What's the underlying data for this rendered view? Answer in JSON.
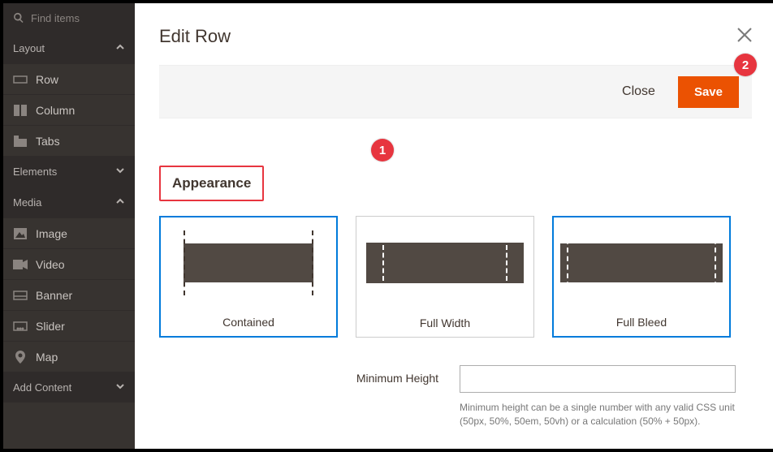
{
  "search": {
    "placeholder": "Find items"
  },
  "sidebar": {
    "groups": {
      "layout": {
        "label": "Layout",
        "expanded": true,
        "items": [
          "Row",
          "Column",
          "Tabs"
        ]
      },
      "elements": {
        "label": "Elements",
        "expanded": false,
        "items": []
      },
      "media": {
        "label": "Media",
        "expanded": true,
        "items": [
          "Image",
          "Video",
          "Banner",
          "Slider",
          "Map"
        ]
      },
      "addcontent": {
        "label": "Add Content",
        "expanded": false,
        "items": []
      }
    }
  },
  "modal": {
    "title": "Edit Row",
    "buttons": {
      "close": "Close",
      "save": "Save"
    },
    "appearance": {
      "section_label": "Appearance",
      "options": [
        {
          "key": "contained",
          "label": "Contained"
        },
        {
          "key": "fullwidth",
          "label": "Full Width"
        },
        {
          "key": "fullbleed",
          "label": "Full Bleed"
        }
      ],
      "selected": [
        "contained",
        "fullbleed"
      ]
    },
    "min_height": {
      "label": "Minimum Height",
      "value": "",
      "hint": "Minimum height can be a single number with any valid CSS unit (50px, 50%, 50em, 50vh) or a calculation (50% + 50px)."
    }
  },
  "annotations": {
    "annot1": "1",
    "annot2": "2"
  }
}
